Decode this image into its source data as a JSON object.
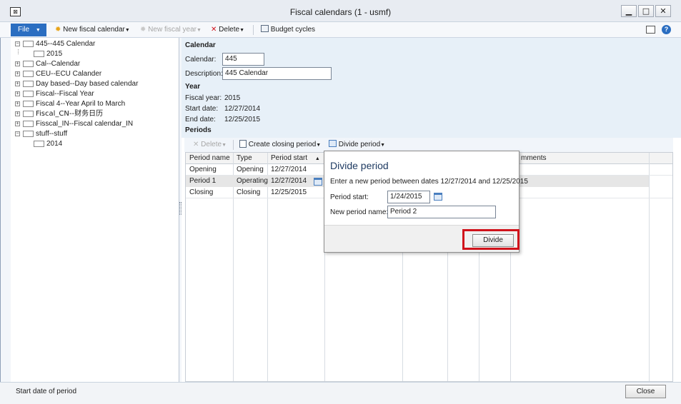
{
  "window": {
    "title": "Fiscal calendars (1 - usmf)",
    "app_icon_glyph": "⊠"
  },
  "toolbar": {
    "file_label": "File",
    "new_fiscal_calendar": "New fiscal calendar",
    "new_fiscal_year": "New fiscal year",
    "delete": "Delete",
    "budget_cycles": "Budget cycles"
  },
  "tree": {
    "items": [
      {
        "label": "445--445 Calendar",
        "expanded": true
      },
      {
        "label": "2015",
        "child": true
      },
      {
        "label": "Cal--Calendar"
      },
      {
        "label": "CEU--ECU Calander"
      },
      {
        "label": "Day based--Day based calendar"
      },
      {
        "label": "Fiscal--Fiscal Year"
      },
      {
        "label": "Fiscal 4--Year April to March"
      },
      {
        "label": "Fiscal_CN--财务日历"
      },
      {
        "label": "Fisscal_IN--Fiscal calendar_IN"
      },
      {
        "label": "stuff--stuff",
        "expanded": true
      },
      {
        "label": "2014",
        "child": true
      }
    ]
  },
  "calendar": {
    "section_label": "Calendar",
    "calendar_label": "Calendar:",
    "calendar_value": "445",
    "description_label": "Description:",
    "description_value": "445 Calendar"
  },
  "year": {
    "section_label": "Year",
    "fiscal_year_label": "Fiscal year:",
    "fiscal_year_value": "2015",
    "start_date_label": "Start date:",
    "start_date_value": "12/27/2014",
    "end_date_label": "End date:",
    "end_date_value": "12/25/2015"
  },
  "periods": {
    "section_label": "Periods",
    "toolbar": {
      "delete": "Delete",
      "create_closing_period": "Create closing period",
      "divide_period": "Divide period"
    },
    "columns": [
      "Period name",
      "Type",
      "Period start",
      "mments"
    ],
    "rows": [
      {
        "name": "Opening",
        "type": "Opening",
        "start": "12/27/2014"
      },
      {
        "name": "Period 1",
        "type": "Operating",
        "start": "12/27/2014"
      },
      {
        "name": "Closing",
        "type": "Closing",
        "start": "12/25/2015"
      }
    ]
  },
  "dialog": {
    "title": "Divide period",
    "instructions": "Enter a new period between dates 12/27/2014 and 12/25/2015",
    "period_start_label": "Period start:",
    "period_start_value": "1/24/2015",
    "new_period_name_label": "New period name:",
    "new_period_name_value": "Period 2",
    "divide_button": "Divide",
    "highlight_color": "#d0121b"
  },
  "status": {
    "text": "Start date of period",
    "close_button": "Close"
  },
  "colors": {
    "accent": "#2b6ec1",
    "header_bg": "#e7f0f8"
  }
}
